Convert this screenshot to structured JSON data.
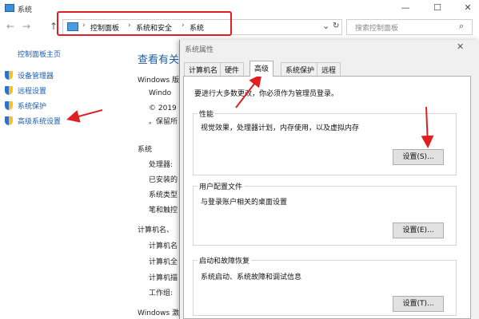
{
  "window": {
    "title": "系统",
    "minimize": "—",
    "maximize": "☐",
    "close": "✕"
  },
  "nav": {
    "back": "←",
    "forward": "→",
    "up": "↑",
    "dropdown": "⌄",
    "refresh": "↻"
  },
  "breadcrumb": [
    "控制面板",
    "系统和安全",
    "系统"
  ],
  "breadcrumb_sep": "›",
  "search": {
    "placeholder": "搜索控制面板",
    "icon": "⌕"
  },
  "sidebar": {
    "home": "控制面板主页",
    "items": [
      {
        "label": "设备管理器",
        "icon": "shield-icon"
      },
      {
        "label": "远程设置",
        "icon": "shield-icon"
      },
      {
        "label": "系统保护",
        "icon": "shield-icon"
      },
      {
        "label": "高级系统设置",
        "icon": "shield-icon"
      }
    ]
  },
  "main": {
    "title": "查看有关",
    "windows_edition": "Windows 版",
    "windows_name": "Windo",
    "copyright": "© 2019",
    "rights": "。保留所",
    "system_heading": "系统",
    "system_rows": [
      "处理器:",
      "已安装的",
      "系统类型",
      "笔和触控"
    ],
    "computer_heading": "计算机名、",
    "computer_rows": [
      "计算机名",
      "计算机全",
      "计算机描",
      "工作组:"
    ],
    "activation": "Windows 激"
  },
  "dialog": {
    "title": "系统属性",
    "close": "✕",
    "tabs": [
      "计算机名",
      "硬件",
      "高级",
      "系统保护",
      "远程"
    ],
    "active_tab": "高级",
    "notice": "要进行大多数更改，你必须作为管理员登录。",
    "groups": [
      {
        "title": "性能",
        "desc": "视觉效果，处理器计划，内存使用，以及虚拟内存",
        "button": "设置(S)..."
      },
      {
        "title": "用户配置文件",
        "desc": "与登录账户相关的桌面设置",
        "button": "设置(E)..."
      },
      {
        "title": "启动和故障恢复",
        "desc": "系统启动、系统故障和调试信息",
        "button": "设置(T)..."
      }
    ]
  },
  "colors": {
    "annotation": "#e02020",
    "link": "#1a5fb4"
  }
}
